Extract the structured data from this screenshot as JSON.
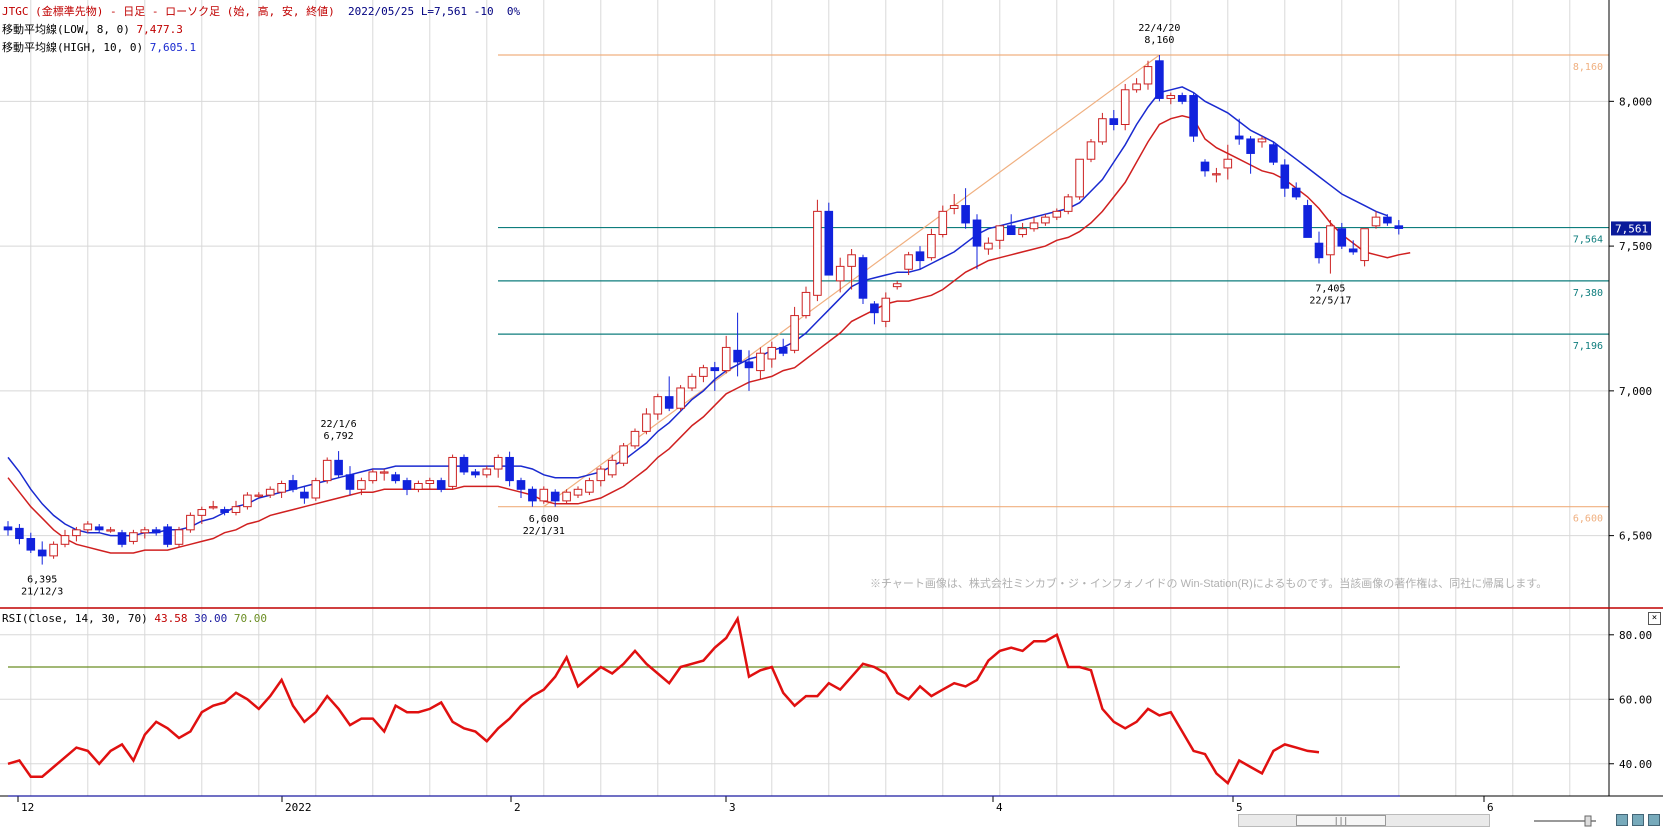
{
  "header": {
    "title": "JTGC (金標準先物) - 日足 - ローソク足 (始, 高, 安, 終値)",
    "date": "2022/05/25",
    "last_label": "L=7,561",
    "change": "-10",
    "change_pct": "0%",
    "ma_low_label": "移動平均線(LOW, 8, 0)",
    "ma_low_value": "7,477.3",
    "ma_high_label": "移動平均線(HIGH, 10, 0)",
    "ma_high_value": "7,605.1"
  },
  "rsi_header": {
    "label": "RSI(Close, 14, 30, 70)",
    "value": "43.58",
    "lower": "30.00",
    "upper": "70.00"
  },
  "watermark": "※チャート画像は、株式会社ミンカブ・ジ・インフォノイドの Win-Station(R)によるものです。当該画像の著作権は、同社に帰属します。",
  "colors": {
    "up_candle": "#cc2222",
    "down_candle": "#1122dd",
    "ma_low": "#d02020",
    "ma_high": "#1a2ad0",
    "fib_line": "#0e7d7d",
    "level_line": "#f0b080",
    "rsi_line": "#e01010",
    "rsi_upper": "#6b8e23",
    "rsi_lower": "#1a1aa0",
    "grid": "#d8d8d8",
    "last_badge": "#0a1a9a"
  },
  "chart_data": [
    {
      "type": "candlestick",
      "ylim": [
        6250,
        8350
      ],
      "y_ticks": [
        "6,500",
        "7,000",
        "7,500",
        "8,000"
      ],
      "x_ticks": [
        "12",
        "2022",
        "2",
        "3",
        "4",
        "5",
        "6"
      ],
      "last_price": "7,561",
      "levels": [
        {
          "label": "8,160",
          "value": 8160,
          "kind": "high"
        },
        {
          "label": "7,564",
          "value": 7564,
          "kind": "fib"
        },
        {
          "label": "7,380",
          "value": 7380,
          "kind": "fib"
        },
        {
          "label": "7,196",
          "value": 7196,
          "kind": "fib"
        },
        {
          "label": "6,600",
          "value": 6600,
          "kind": "low"
        }
      ],
      "annotations": [
        {
          "date": "21/12/3",
          "price": "6,395",
          "pos": "below"
        },
        {
          "date": "22/1/6",
          "price": "6,792",
          "pos": "above"
        },
        {
          "date": "22/1/31",
          "price": "6,600",
          "pos": "below"
        },
        {
          "date": "22/4/20",
          "price": "8,160",
          "pos": "above"
        },
        {
          "date": "22/5/17",
          "price": "7,405",
          "pos": "below"
        }
      ],
      "ohlc": [
        [
          6530,
          6550,
          6500,
          6520
        ],
        [
          6525,
          6540,
          6470,
          6490
        ],
        [
          6490,
          6510,
          6440,
          6450
        ],
        [
          6450,
          6480,
          6400,
          6430
        ],
        [
          6430,
          6480,
          6420,
          6470
        ],
        [
          6470,
          6520,
          6460,
          6500
        ],
        [
          6500,
          6530,
          6480,
          6520
        ],
        [
          6520,
          6550,
          6510,
          6540
        ],
        [
          6530,
          6540,
          6510,
          6520
        ],
        [
          6520,
          6530,
          6510,
          6520
        ],
        [
          6510,
          6520,
          6460,
          6470
        ],
        [
          6480,
          6520,
          6470,
          6510
        ],
        [
          6510,
          6530,
          6490,
          6520
        ],
        [
          6520,
          6530,
          6500,
          6510
        ],
        [
          6530,
          6540,
          6460,
          6470
        ],
        [
          6470,
          6530,
          6460,
          6520
        ],
        [
          6520,
          6580,
          6510,
          6570
        ],
        [
          6570,
          6600,
          6540,
          6590
        ],
        [
          6600,
          6620,
          6590,
          6600
        ],
        [
          6590,
          6600,
          6570,
          6580
        ],
        [
          6580,
          6620,
          6570,
          6600
        ],
        [
          6600,
          6650,
          6590,
          6640
        ],
        [
          6640,
          6650,
          6630,
          6640
        ],
        [
          6640,
          6670,
          6630,
          6660
        ],
        [
          6650,
          6690,
          6630,
          6680
        ],
        [
          6690,
          6710,
          6650,
          6660
        ],
        [
          6650,
          6670,
          6610,
          6630
        ],
        [
          6630,
          6700,
          6620,
          6690
        ],
        [
          6690,
          6770,
          6680,
          6760
        ],
        [
          6760,
          6792,
          6700,
          6710
        ],
        [
          6710,
          6740,
          6640,
          6660
        ],
        [
          6660,
          6700,
          6640,
          6690
        ],
        [
          6690,
          6730,
          6680,
          6720
        ],
        [
          6720,
          6730,
          6690,
          6720
        ],
        [
          6710,
          6720,
          6680,
          6690
        ],
        [
          6690,
          6700,
          6640,
          6660
        ],
        [
          6660,
          6690,
          6650,
          6680
        ],
        [
          6680,
          6700,
          6660,
          6690
        ],
        [
          6690,
          6700,
          6650,
          6660
        ],
        [
          6670,
          6780,
          6660,
          6770
        ],
        [
          6770,
          6780,
          6710,
          6720
        ],
        [
          6720,
          6730,
          6700,
          6710
        ],
        [
          6710,
          6740,
          6700,
          6730
        ],
        [
          6730,
          6780,
          6700,
          6770
        ],
        [
          6770,
          6790,
          6670,
          6690
        ],
        [
          6690,
          6700,
          6630,
          6660
        ],
        [
          6660,
          6670,
          6600,
          6620
        ],
        [
          6620,
          6670,
          6610,
          6660
        ],
        [
          6650,
          6660,
          6600,
          6620
        ],
        [
          6620,
          6660,
          6610,
          6650
        ],
        [
          6640,
          6670,
          6630,
          6660
        ],
        [
          6650,
          6700,
          6640,
          6690
        ],
        [
          6690,
          6740,
          6670,
          6730
        ],
        [
          6710,
          6780,
          6700,
          6760
        ],
        [
          6750,
          6820,
          6740,
          6810
        ],
        [
          6810,
          6870,
          6800,
          6860
        ],
        [
          6860,
          6940,
          6850,
          6920
        ],
        [
          6920,
          6990,
          6900,
          6980
        ],
        [
          6980,
          7050,
          6930,
          6940
        ],
        [
          6940,
          7020,
          6930,
          7010
        ],
        [
          7010,
          7060,
          7000,
          7050
        ],
        [
          7050,
          7090,
          7030,
          7080
        ],
        [
          7080,
          7100,
          7000,
          7070
        ],
        [
          7070,
          7190,
          7060,
          7150
        ],
        [
          7140,
          7270,
          7050,
          7100
        ],
        [
          7100,
          7140,
          7000,
          7080
        ],
        [
          7070,
          7150,
          7040,
          7130
        ],
        [
          7110,
          7170,
          7080,
          7150
        ],
        [
          7150,
          7180,
          7120,
          7130
        ],
        [
          7140,
          7290,
          7130,
          7260
        ],
        [
          7260,
          7360,
          7250,
          7340
        ],
        [
          7330,
          7660,
          7310,
          7620
        ],
        [
          7620,
          7650,
          7400,
          7400
        ],
        [
          7380,
          7460,
          7340,
          7430
        ],
        [
          7430,
          7490,
          7350,
          7470
        ],
        [
          7460,
          7470,
          7300,
          7320
        ],
        [
          7300,
          7310,
          7230,
          7270
        ],
        [
          7240,
          7340,
          7220,
          7320
        ],
        [
          7360,
          7380,
          7350,
          7370
        ],
        [
          7420,
          7480,
          7400,
          7470
        ],
        [
          7480,
          7500,
          7420,
          7450
        ],
        [
          7460,
          7560,
          7450,
          7540
        ],
        [
          7540,
          7640,
          7530,
          7620
        ],
        [
          7630,
          7680,
          7610,
          7640
        ],
        [
          7640,
          7700,
          7560,
          7580
        ],
        [
          7590,
          7610,
          7420,
          7500
        ],
        [
          7490,
          7530,
          7470,
          7510
        ],
        [
          7520,
          7560,
          7490,
          7570
        ],
        [
          7570,
          7610,
          7560,
          7540
        ],
        [
          7540,
          7580,
          7530,
          7560
        ],
        [
          7560,
          7600,
          7550,
          7580
        ],
        [
          7580,
          7610,
          7570,
          7600
        ],
        [
          7600,
          7630,
          7590,
          7620
        ],
        [
          7620,
          7680,
          7610,
          7670
        ],
        [
          7670,
          7800,
          7660,
          7800
        ],
        [
          7800,
          7870,
          7790,
          7860
        ],
        [
          7860,
          7960,
          7850,
          7940
        ],
        [
          7940,
          7970,
          7900,
          7920
        ],
        [
          7920,
          8060,
          7900,
          8040
        ],
        [
          8040,
          8080,
          8030,
          8060
        ],
        [
          8060,
          8140,
          8040,
          8120
        ],
        [
          8140,
          8160,
          8000,
          8010
        ],
        [
          8010,
          8030,
          7990,
          8020
        ],
        [
          8020,
          8030,
          7990,
          8000
        ],
        [
          8020,
          8030,
          7860,
          7880
        ],
        [
          7790,
          7800,
          7740,
          7760
        ],
        [
          7750,
          7770,
          7720,
          7750
        ],
        [
          7770,
          7850,
          7730,
          7800
        ],
        [
          7880,
          7940,
          7850,
          7870
        ],
        [
          7870,
          7880,
          7750,
          7820
        ],
        [
          7860,
          7880,
          7840,
          7870
        ],
        [
          7850,
          7860,
          7780,
          7790
        ],
        [
          7780,
          7800,
          7670,
          7700
        ],
        [
          7700,
          7720,
          7660,
          7670
        ],
        [
          7640,
          7660,
          7530,
          7530
        ],
        [
          7510,
          7550,
          7440,
          7460
        ],
        [
          7470,
          7590,
          7405,
          7570
        ],
        [
          7560,
          7580,
          7490,
          7500
        ],
        [
          7490,
          7520,
          7470,
          7480
        ],
        [
          7450,
          7560,
          7430,
          7560
        ],
        [
          7570,
          7620,
          7560,
          7600
        ],
        [
          7600,
          7610,
          7570,
          7580
        ],
        [
          7570,
          7590,
          7540,
          7561
        ]
      ],
      "ma_low": [
        6700,
        6650,
        6600,
        6560,
        6520,
        6490,
        6470,
        6460,
        6450,
        6440,
        6440,
        6440,
        6450,
        6450,
        6450,
        6460,
        6470,
        6480,
        6490,
        6510,
        6520,
        6540,
        6550,
        6570,
        6580,
        6590,
        6600,
        6610,
        6620,
        6630,
        6640,
        6650,
        6650,
        6660,
        6660,
        6660,
        6660,
        6660,
        6660,
        6660,
        6670,
        6670,
        6670,
        6670,
        6660,
        6650,
        6640,
        6620,
        6610,
        6610,
        6610,
        6620,
        6630,
        6650,
        6670,
        6700,
        6730,
        6770,
        6800,
        6840,
        6880,
        6910,
        6950,
        6990,
        7010,
        7030,
        7040,
        7050,
        7070,
        7080,
        7110,
        7140,
        7170,
        7200,
        7240,
        7260,
        7280,
        7300,
        7310,
        7310,
        7320,
        7330,
        7350,
        7380,
        7410,
        7430,
        7450,
        7460,
        7470,
        7480,
        7490,
        7500,
        7520,
        7530,
        7550,
        7580,
        7620,
        7670,
        7720,
        7790,
        7860,
        7920,
        7940,
        7950,
        7940,
        7870,
        7840,
        7820,
        7800,
        7780,
        7760,
        7750,
        7730,
        7700,
        7670,
        7630,
        7580,
        7540,
        7510,
        7480,
        7470,
        7460,
        7470,
        7477.3
      ],
      "ma_high": [
        6770,
        6720,
        6660,
        6610,
        6570,
        6540,
        6520,
        6510,
        6510,
        6500,
        6500,
        6500,
        6510,
        6510,
        6520,
        6520,
        6530,
        6550,
        6560,
        6580,
        6600,
        6610,
        6630,
        6640,
        6650,
        6660,
        6670,
        6680,
        6690,
        6700,
        6710,
        6720,
        6730,
        6730,
        6740,
        6740,
        6740,
        6740,
        6740,
        6740,
        6740,
        6740,
        6740,
        6740,
        6740,
        6740,
        6730,
        6710,
        6700,
        6700,
        6700,
        6710,
        6720,
        6740,
        6760,
        6790,
        6820,
        6860,
        6890,
        6930,
        6970,
        7000,
        7040,
        7070,
        7090,
        7110,
        7120,
        7140,
        7150,
        7170,
        7200,
        7240,
        7280,
        7320,
        7360,
        7380,
        7390,
        7400,
        7410,
        7410,
        7420,
        7440,
        7460,
        7480,
        7510,
        7540,
        7560,
        7570,
        7580,
        7590,
        7600,
        7610,
        7620,
        7630,
        7650,
        7690,
        7730,
        7790,
        7850,
        7920,
        7980,
        8030,
        8040,
        8050,
        8030,
        8000,
        7980,
        7960,
        7930,
        7900,
        7880,
        7860,
        7830,
        7800,
        7770,
        7740,
        7710,
        7680,
        7660,
        7640,
        7620,
        7605.1
      ]
    },
    {
      "type": "line",
      "ylim": [
        30,
        88
      ],
      "y_ticks": [
        "80.00",
        "60.00",
        "40.00"
      ],
      "upper": 70,
      "lower": 30,
      "rsi": [
        40,
        41,
        36,
        36,
        39,
        42,
        45,
        44,
        40,
        44,
        46,
        41,
        49,
        53,
        51,
        48,
        50,
        56,
        58,
        59,
        62,
        60,
        57,
        61,
        66,
        58,
        53,
        56,
        61,
        57,
        52,
        54,
        54,
        50,
        58,
        56,
        56,
        57,
        59,
        53,
        51,
        50,
        47,
        51,
        54,
        58,
        61,
        63,
        67,
        73,
        64,
        67,
        70,
        68,
        71,
        75,
        71,
        68,
        65,
        70,
        71,
        72,
        76,
        79,
        85,
        67,
        69,
        70,
        62,
        58,
        61,
        61,
        65,
        63,
        67,
        71,
        70,
        68,
        62,
        60,
        64,
        61,
        63,
        65,
        64,
        66,
        72,
        75,
        76,
        75,
        78,
        78,
        80,
        70,
        70,
        69,
        57,
        53,
        51,
        53,
        57,
        55,
        56,
        50,
        44,
        43,
        37,
        34,
        41,
        39,
        37,
        44,
        46,
        45,
        44,
        43.58
      ]
    }
  ]
}
